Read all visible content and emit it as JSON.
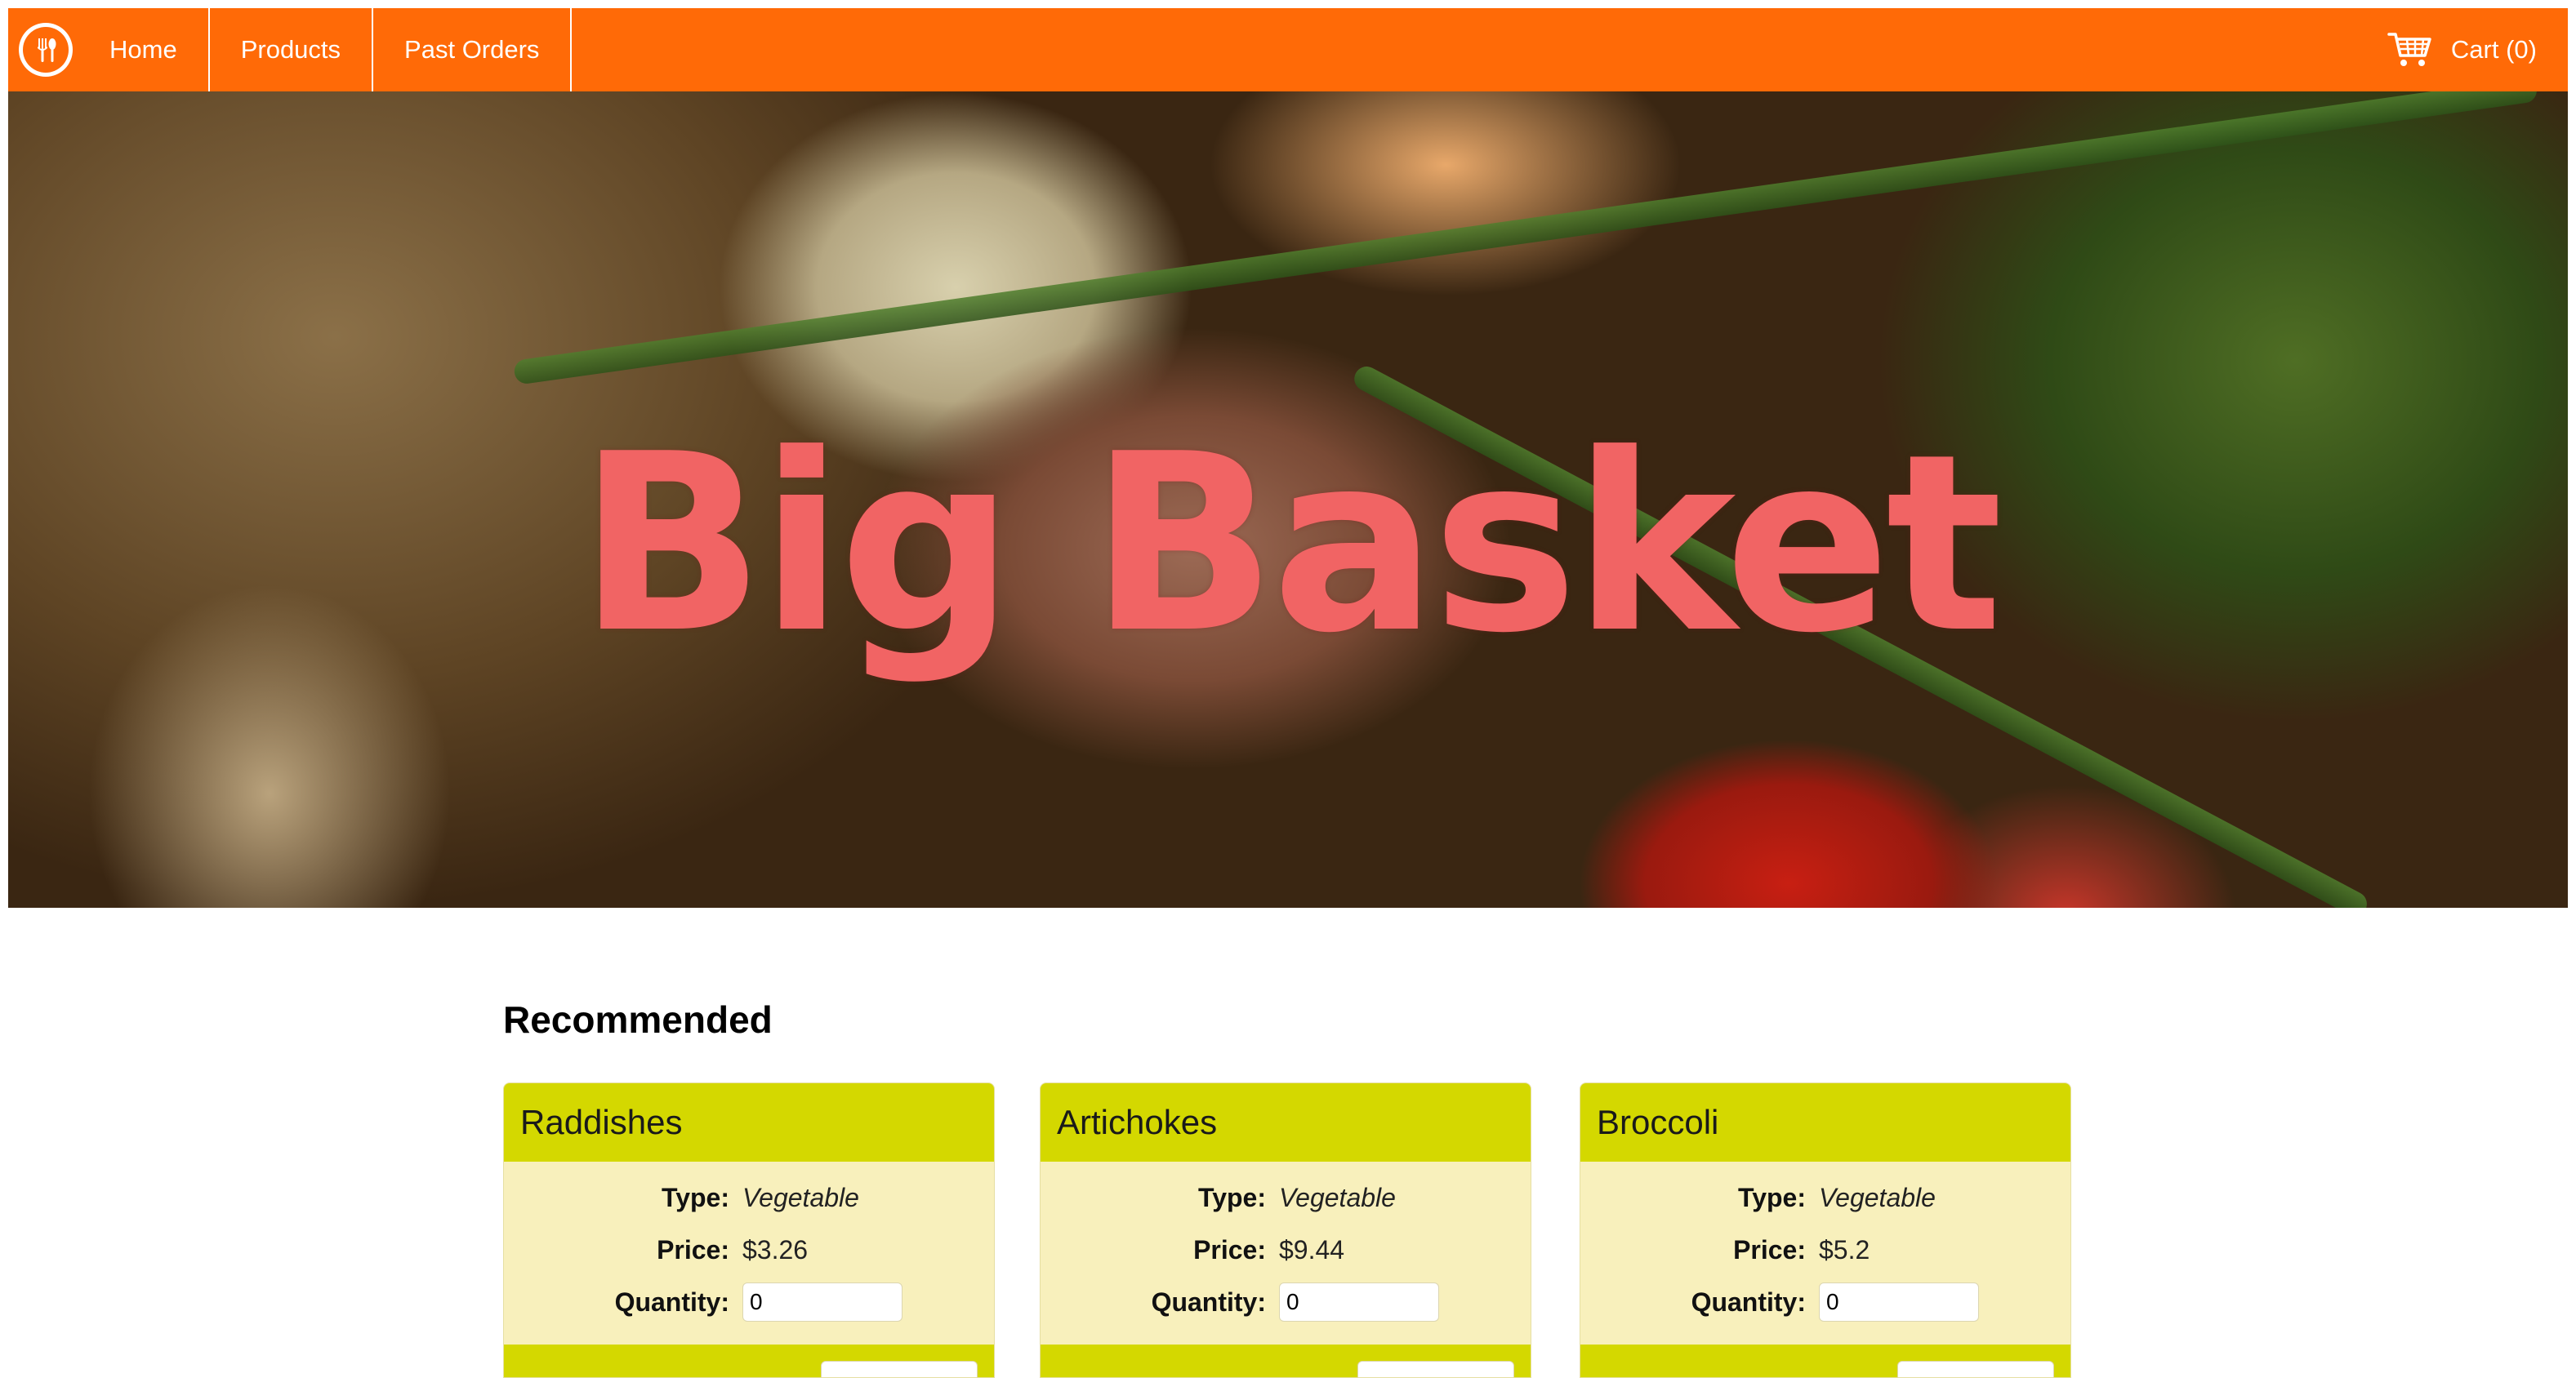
{
  "navbar": {
    "brand_icon": "restaurant-icon",
    "items": [
      {
        "label": "Home"
      },
      {
        "label": "Products"
      },
      {
        "label": "Past Orders"
      }
    ],
    "cart": {
      "icon": "cart-icon",
      "label": "Cart (0)"
    },
    "color": "#FF6A07"
  },
  "hero": {
    "title": "Big Basket",
    "title_color": "#F16464"
  },
  "recommended": {
    "heading": "Recommended",
    "labels": {
      "type": "Type:",
      "price": "Price:",
      "quantity": "Quantity:"
    },
    "products": [
      {
        "name": "Raddishes",
        "type": "Vegetable",
        "price": "$3.26",
        "quantity": "0"
      },
      {
        "name": "Artichokes",
        "type": "Vegetable",
        "price": "$9.44",
        "quantity": "0"
      },
      {
        "name": "Broccoli",
        "type": "Vegetable",
        "price": "$5.2",
        "quantity": "0"
      }
    ],
    "card_header_color": "#D4D800",
    "card_body_color": "#F8F0BC"
  }
}
